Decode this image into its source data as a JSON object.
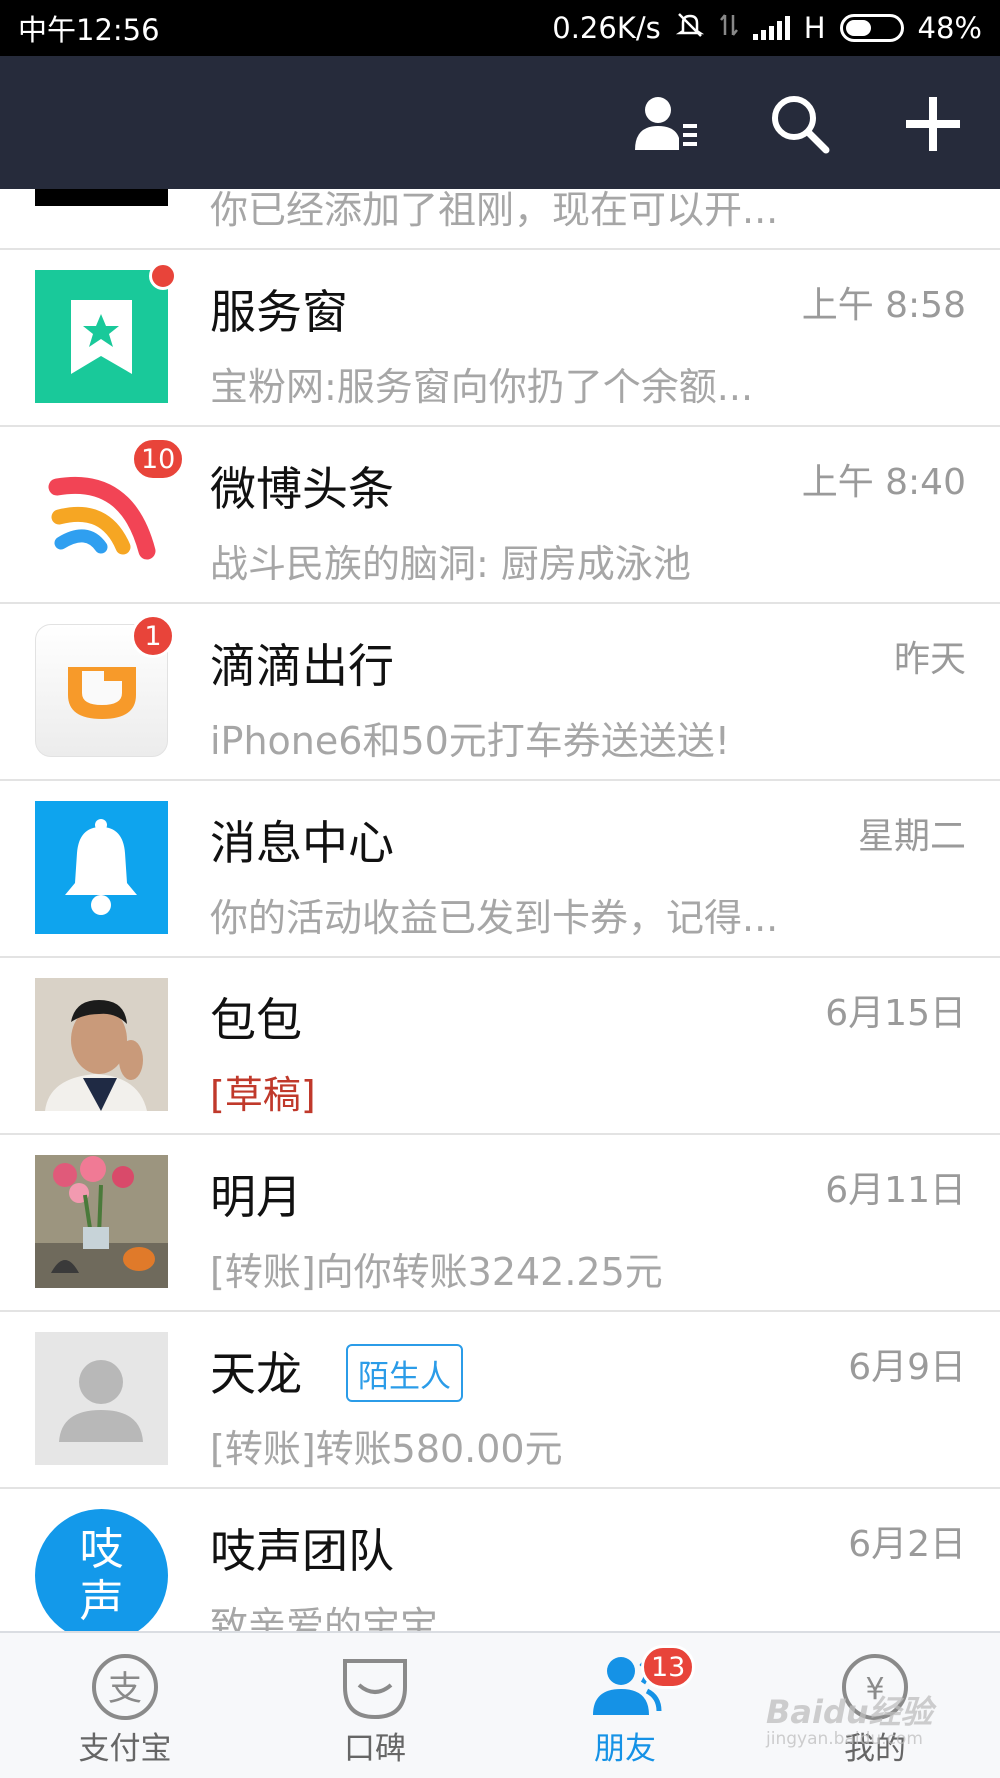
{
  "status_bar": {
    "time": "中午12:56",
    "speed": "0.26K/s",
    "network": "H",
    "battery": "48%",
    "battery_level": 0.48
  },
  "header": {
    "icons": [
      "contacts-list-icon",
      "search-icon",
      "add-icon"
    ]
  },
  "conversations": [
    {
      "name": "",
      "time": "",
      "preview": "你已经添加了祖刚，现在可以开...",
      "avatar": "black-square"
    },
    {
      "name": "服务窗",
      "time": "上午 8:58",
      "preview": "宝粉网:服务窗向你扔了个余额...",
      "avatar": "service-window-icon",
      "unread_dot": true
    },
    {
      "name": "微博头条",
      "time": "上午 8:40",
      "preview": "战斗民族的脑洞: 厨房成泳池",
      "avatar": "weibo-headline-icon",
      "badge": "10"
    },
    {
      "name": "滴滴出行",
      "time": "昨天",
      "preview": "iPhone6和50元打车券送送送!",
      "avatar": "didi-icon",
      "badge": "1"
    },
    {
      "name": "消息中心",
      "time": "星期二",
      "preview": "你的活动收益已发到卡券，记得...",
      "avatar": "bell-icon"
    },
    {
      "name": "包包",
      "time": "6月15日",
      "preview": "[草稿]",
      "avatar": "user-photo",
      "draft": true
    },
    {
      "name": "明月",
      "time": "6月11日",
      "preview": "[转账]向你转账3242.25元",
      "avatar": "flowers-photo"
    },
    {
      "name": "天龙",
      "time": "6月9日",
      "preview": "[转账]转账580.00元",
      "avatar": "default-user-icon",
      "tag": "陌生人"
    },
    {
      "name": "吱声团队",
      "time": "6月2日",
      "preview": "致亲爱的宝宝",
      "avatar": "zhisheng-icon",
      "avatar_text": "吱声"
    }
  ],
  "tabs": [
    {
      "label": "支付宝",
      "icon": "alipay-icon"
    },
    {
      "label": "口碑",
      "icon": "koubei-icon"
    },
    {
      "label": "朋友",
      "icon": "friends-icon",
      "badge": "13",
      "active": true
    },
    {
      "label": "我的",
      "icon": "wallet-icon"
    }
  ],
  "watermark": {
    "line1": "Baidu经验",
    "line2": "jingyan.baidu.com"
  },
  "colors": {
    "header": "#262b3b",
    "badge": "#e8443a",
    "active_tab": "#1592e6",
    "draft": "#c0392b",
    "tag": "#2b9ce8"
  }
}
